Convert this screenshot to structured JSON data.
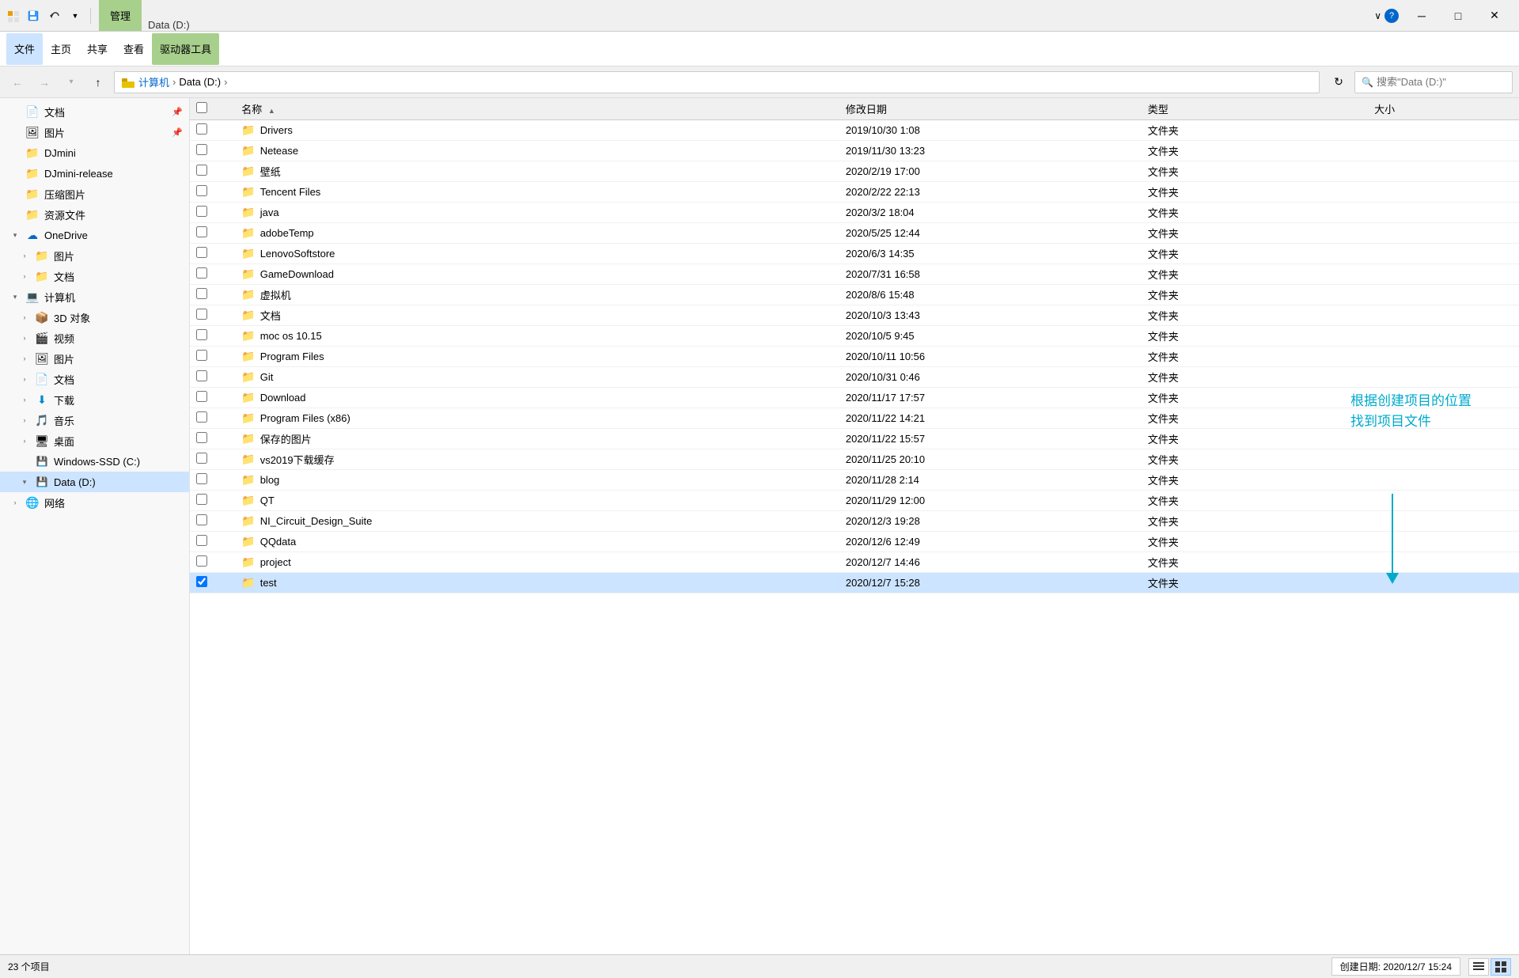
{
  "titleBar": {
    "managementTab": "管理",
    "driveTitle": "Data (D:)",
    "tabs": [
      "文件",
      "主页",
      "共享",
      "查看",
      "驱动器工具"
    ],
    "windowControls": {
      "minimize": "─",
      "maximize": "□",
      "close": "✕"
    },
    "helpIcon": "?",
    "chevron": "∨"
  },
  "ribbon": {
    "activeTab": "管理",
    "driveTools": "驱动器工具",
    "buttons": [
      {
        "label": "文件",
        "id": "tab-file"
      },
      {
        "label": "主页",
        "id": "tab-home"
      },
      {
        "label": "共享",
        "id": "tab-share"
      },
      {
        "label": "查看",
        "id": "tab-view"
      },
      {
        "label": "驱动器工具",
        "id": "tab-drive"
      }
    ]
  },
  "addressBar": {
    "back": "←",
    "forward": "→",
    "up": "↑",
    "path": [
      "计算机",
      "Data (D:)"
    ],
    "refresh": "↻",
    "searchPlaceholder": "搜索\"Data (D:)\""
  },
  "sidebar": {
    "items": [
      {
        "id": "docs",
        "label": "文档",
        "icon": "📄",
        "pin": "📌",
        "indent": 0
      },
      {
        "id": "pics",
        "label": "图片",
        "icon": "🖼",
        "pin": "📌",
        "indent": 0
      },
      {
        "id": "djmini",
        "label": "DJmini",
        "icon": "📁",
        "indent": 0
      },
      {
        "id": "djmini-release",
        "label": "DJmini-release",
        "icon": "📁",
        "indent": 0
      },
      {
        "id": "compress-pics",
        "label": "压缩图片",
        "icon": "📁",
        "indent": 0
      },
      {
        "id": "resources",
        "label": "资源文件",
        "icon": "📁",
        "indent": 0
      },
      {
        "id": "onedrive",
        "label": "OneDrive",
        "icon": "☁",
        "indent": 0,
        "expanded": true
      },
      {
        "id": "onedrive-pics",
        "label": "图片",
        "icon": "📁",
        "indent": 1
      },
      {
        "id": "onedrive-docs",
        "label": "文档",
        "icon": "📁",
        "indent": 1
      },
      {
        "id": "computer",
        "label": "计算机",
        "icon": "💻",
        "indent": 0,
        "expanded": true
      },
      {
        "id": "3d",
        "label": "3D 对象",
        "icon": "📦",
        "indent": 1
      },
      {
        "id": "video",
        "label": "视频",
        "icon": "🎬",
        "indent": 1
      },
      {
        "id": "image",
        "label": "图片",
        "icon": "🖼",
        "indent": 1
      },
      {
        "id": "document",
        "label": "文档",
        "icon": "📄",
        "indent": 1
      },
      {
        "id": "downloads",
        "label": "下载",
        "icon": "⬇",
        "indent": 1
      },
      {
        "id": "music",
        "label": "音乐",
        "icon": "🎵",
        "indent": 1
      },
      {
        "id": "desktop",
        "label": "桌面",
        "icon": "🖥",
        "indent": 1
      },
      {
        "id": "windows-ssd",
        "label": "Windows-SSD (C:)",
        "icon": "💾",
        "indent": 1
      },
      {
        "id": "data-d",
        "label": "Data (D:)",
        "icon": "💾",
        "indent": 1,
        "selected": true
      },
      {
        "id": "network",
        "label": "网络",
        "icon": "🌐",
        "indent": 0
      }
    ]
  },
  "fileList": {
    "columns": [
      {
        "id": "name",
        "label": "名称",
        "sortArrow": "▲"
      },
      {
        "id": "date",
        "label": "修改日期"
      },
      {
        "id": "type",
        "label": "类型"
      },
      {
        "id": "size",
        "label": "大小"
      }
    ],
    "files": [
      {
        "name": "Drivers",
        "date": "2019/10/30 1:08",
        "type": "文件夹",
        "size": "",
        "selected": false
      },
      {
        "name": "Netease",
        "date": "2019/11/30 13:23",
        "type": "文件夹",
        "size": "",
        "selected": false
      },
      {
        "name": "壁纸",
        "date": "2020/2/19 17:00",
        "type": "文件夹",
        "size": "",
        "selected": false
      },
      {
        "name": "Tencent Files",
        "date": "2020/2/22 22:13",
        "type": "文件夹",
        "size": "",
        "selected": false
      },
      {
        "name": "java",
        "date": "2020/3/2 18:04",
        "type": "文件夹",
        "size": "",
        "selected": false
      },
      {
        "name": "adobeTemp",
        "date": "2020/5/25 12:44",
        "type": "文件夹",
        "size": "",
        "selected": false
      },
      {
        "name": "LenovoSoftstore",
        "date": "2020/6/3 14:35",
        "type": "文件夹",
        "size": "",
        "selected": false
      },
      {
        "name": "GameDownload",
        "date": "2020/7/31 16:58",
        "type": "文件夹",
        "size": "",
        "selected": false
      },
      {
        "name": "虚拟机",
        "date": "2020/8/6 15:48",
        "type": "文件夹",
        "size": "",
        "selected": false
      },
      {
        "name": "文档",
        "date": "2020/10/3 13:43",
        "type": "文件夹",
        "size": "",
        "selected": false
      },
      {
        "name": "moc os 10.15",
        "date": "2020/10/5 9:45",
        "type": "文件夹",
        "size": "",
        "selected": false
      },
      {
        "name": "Program Files",
        "date": "2020/10/11 10:56",
        "type": "文件夹",
        "size": "",
        "selected": false
      },
      {
        "name": "Git",
        "date": "2020/10/31 0:46",
        "type": "文件夹",
        "size": "",
        "selected": false
      },
      {
        "name": "Download",
        "date": "2020/11/17 17:57",
        "type": "文件夹",
        "size": "",
        "selected": false
      },
      {
        "name": "Program Files (x86)",
        "date": "2020/11/22 14:21",
        "type": "文件夹",
        "size": "",
        "selected": false
      },
      {
        "name": "保存的图片",
        "date": "2020/11/22 15:57",
        "type": "文件夹",
        "size": "",
        "selected": false
      },
      {
        "name": "vs2019下载缓存",
        "date": "2020/11/25 20:10",
        "type": "文件夹",
        "size": "",
        "selected": false
      },
      {
        "name": "blog",
        "date": "2020/11/28 2:14",
        "type": "文件夹",
        "size": "",
        "selected": false
      },
      {
        "name": "QT",
        "date": "2020/11/29 12:00",
        "type": "文件夹",
        "size": "",
        "selected": false
      },
      {
        "name": "NI_Circuit_Design_Suite",
        "date": "2020/12/3 19:28",
        "type": "文件夹",
        "size": "",
        "selected": false
      },
      {
        "name": "QQdata",
        "date": "2020/12/6 12:49",
        "type": "文件夹",
        "size": "",
        "selected": false
      },
      {
        "name": "project",
        "date": "2020/12/7 14:46",
        "type": "文件夹",
        "size": "",
        "selected": false
      },
      {
        "name": "test",
        "date": "2020/12/7 15:28",
        "type": "文件夹",
        "size": "",
        "selected": true
      }
    ]
  },
  "annotation": {
    "text": "根据创建项目的位置\n找到项目文件",
    "arrowColor": "#00aacc"
  },
  "statusBar": {
    "count": "23 个项目",
    "dateLabel": "创建日期: 2020/12/7 15:24"
  }
}
